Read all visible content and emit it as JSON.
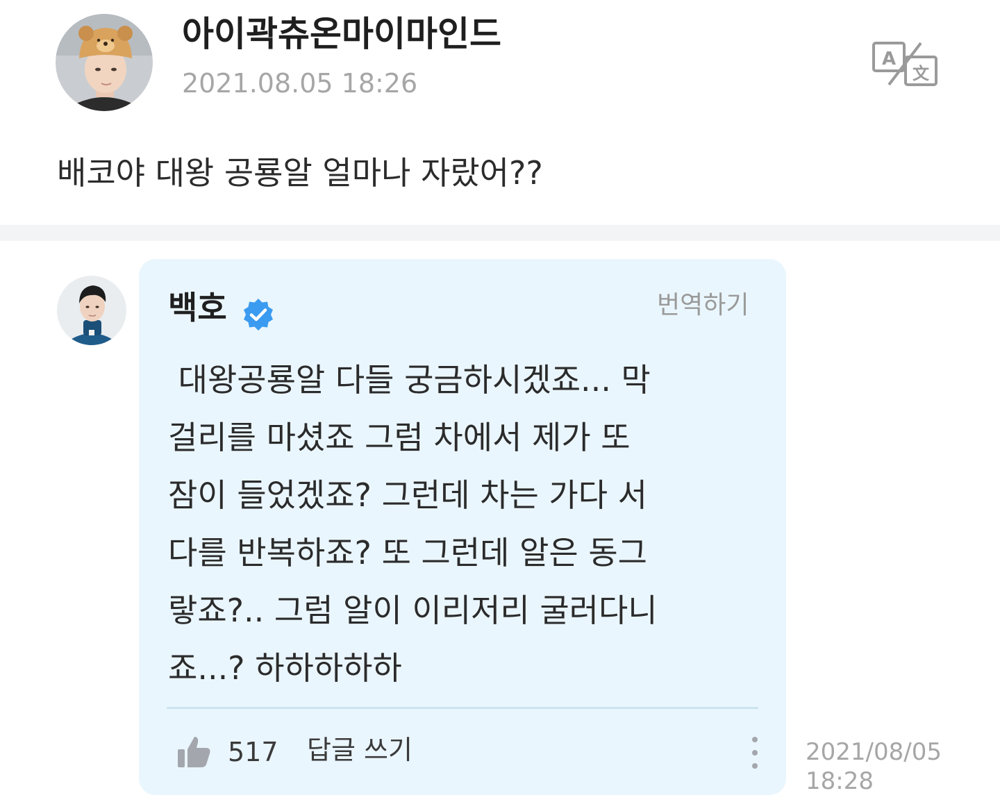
{
  "post": {
    "author": "아이곽츄온마이마인드",
    "date": "2021.08.05 18:26",
    "body": "배코야 대왕 공룡알 얼마나 자랐어??",
    "translate_icon": "translate-icon"
  },
  "reply": {
    "author": "백호",
    "verified_icon": "verified-badge-icon",
    "translate_label": "번역하기",
    "lines": [
      " 대왕공룡알 다들 궁금하시겠죠... 막",
      "걸리를 마셨죠 그럼 차에서 제가 또",
      "잠이 들었겠죠? 그런데 차는 가다 서",
      "다를 반복하죠? 또 그런데 알은 동그",
      "랗죠?.. 그럼 알이 이리저리 굴러다니",
      "죠...? 하하하하하"
    ],
    "like_icon": "thumbs-up-icon",
    "like_count": "517",
    "reply_button": "답글 쓰기",
    "more_icon": "more-vertical-icon",
    "date_line1": "2021/08/05",
    "date_line2": "18:28"
  },
  "colors": {
    "reply_background": "#eaf6fd",
    "verified_blue": "#3b9bf0",
    "muted_text": "#a6a6a6",
    "divider": "#f3f4f6"
  }
}
